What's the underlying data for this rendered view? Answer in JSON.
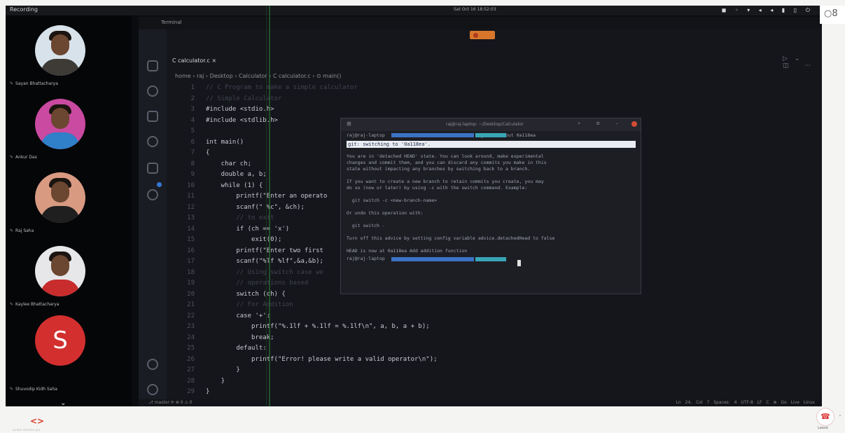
{
  "meeting": {
    "recording_label": "Recording",
    "clock": "Sat Oct 16 18:52:03",
    "participants": [
      {
        "name": "Sayan Bhattacharya",
        "shirt": "#3e3a35"
      },
      {
        "name": "Ankur Das",
        "shirt": "#2f7fc9"
      },
      {
        "name": "Raj Saha",
        "shirt": "#1f1f1f"
      },
      {
        "name": "Kaylee Bhattacharya",
        "shirt": "#c82c2c"
      },
      {
        "name": "Shuvodip Kidh Saha",
        "initial": "S",
        "color": "#d32f2f"
      }
    ],
    "more_icon": "chevron-down-icon",
    "leave_label": "Leave",
    "leave_icon": "phone-hangup-icon",
    "me_icon": "person-icon"
  },
  "editor": {
    "window_title": "Terminal",
    "tab_label": "C calculator.c ×",
    "breadcrumb": "home › raj › Desktop › Calculator › C calculator.c › ⊙ main()",
    "code_lines": [
      {
        "n": "1",
        "t": "// C Program to make a simple calculator",
        "dim": true
      },
      {
        "n": "2",
        "t": "// Simple Calculator",
        "dim": true
      },
      {
        "n": "3",
        "t": "#include <stdio.h>"
      },
      {
        "n": "4",
        "t": "#include <stdlib.h>"
      },
      {
        "n": "5",
        "t": ""
      },
      {
        "n": "6",
        "t": "int main()"
      },
      {
        "n": "7",
        "t": "{"
      },
      {
        "n": "8",
        "t": "    char ch;"
      },
      {
        "n": "9",
        "t": "    double a, b;"
      },
      {
        "n": "10",
        "t": "    while (1) {"
      },
      {
        "n": "11",
        "t": "        printf(\"Enter an operato"
      },
      {
        "n": "12",
        "t": "        scanf(\" %c\", &ch);"
      },
      {
        "n": "13",
        "t": "        // to exit",
        "dim": true
      },
      {
        "n": "14",
        "t": "        if (ch == 'x')"
      },
      {
        "n": "15",
        "t": "            exit(0);"
      },
      {
        "n": "16",
        "t": "        printf(\"Enter two first"
      },
      {
        "n": "17",
        "t": "        scanf(\"%lf %lf\",&a,&b);"
      },
      {
        "n": "18",
        "t": "        // Using switch case we",
        "dim": true
      },
      {
        "n": "19",
        "t": "        // operations based",
        "dim": true
      },
      {
        "n": "20",
        "t": "        switch (ch) {"
      },
      {
        "n": "21",
        "t": "        // For Addition",
        "dim": true
      },
      {
        "n": "22",
        "t": "        case '+':"
      },
      {
        "n": "23",
        "t": "            printf(\"%.1lf + %.1lf = %.1lf\\n\", a, b, a + b);"
      },
      {
        "n": "24",
        "t": "            break;"
      },
      {
        "n": "25",
        "t": "        default:"
      },
      {
        "n": "26",
        "t": "            printf(\"Error! please write a valid operator\\n\");"
      },
      {
        "n": "27",
        "t": "        }"
      },
      {
        "n": "28",
        "t": "    }"
      },
      {
        "n": "29",
        "t": "}"
      }
    ],
    "status_left": "⎇ master   ⟳   ⊗ 0 ⚠ 0",
    "status_right": "Ln 24, Col 7   Spaces: 4   UTF-8   LF   C   ⊕ Go Live   Linux"
  },
  "terminal": {
    "title": "raj@raj-laptop: ~/Desktop/Calculator",
    "cmd_line": "raj@raj-laptop                                   git checkout 0a118ea",
    "highlight": "git: switching to '0a118ea'.",
    "body": [
      "You are in 'detached HEAD' state. You can look around, make experimental",
      "changes and commit them, and you can discard any commits you make in this",
      "state without impacting any branches by switching back to a branch.",
      "",
      "If you want to create a new branch to retain commits you create, you may",
      "do so (now or later) by using -c with the switch command. Example:",
      "",
      "  git switch -c <new-branch-name>",
      "",
      "Or undo this operation with:",
      "",
      "  git switch -",
      "",
      "Turn off this advice by setting config variable advice.detachedHead to false",
      "",
      "HEAD is now at 0a118ea Add addition function"
    ],
    "prompt": "raj@raj-laptop"
  },
  "footer": {
    "logo_text": "<>",
    "logo_caption": "screen recorder pro",
    "logo_colors": {
      "left": "#d93a2b",
      "right": "#3b6fd6"
    }
  }
}
